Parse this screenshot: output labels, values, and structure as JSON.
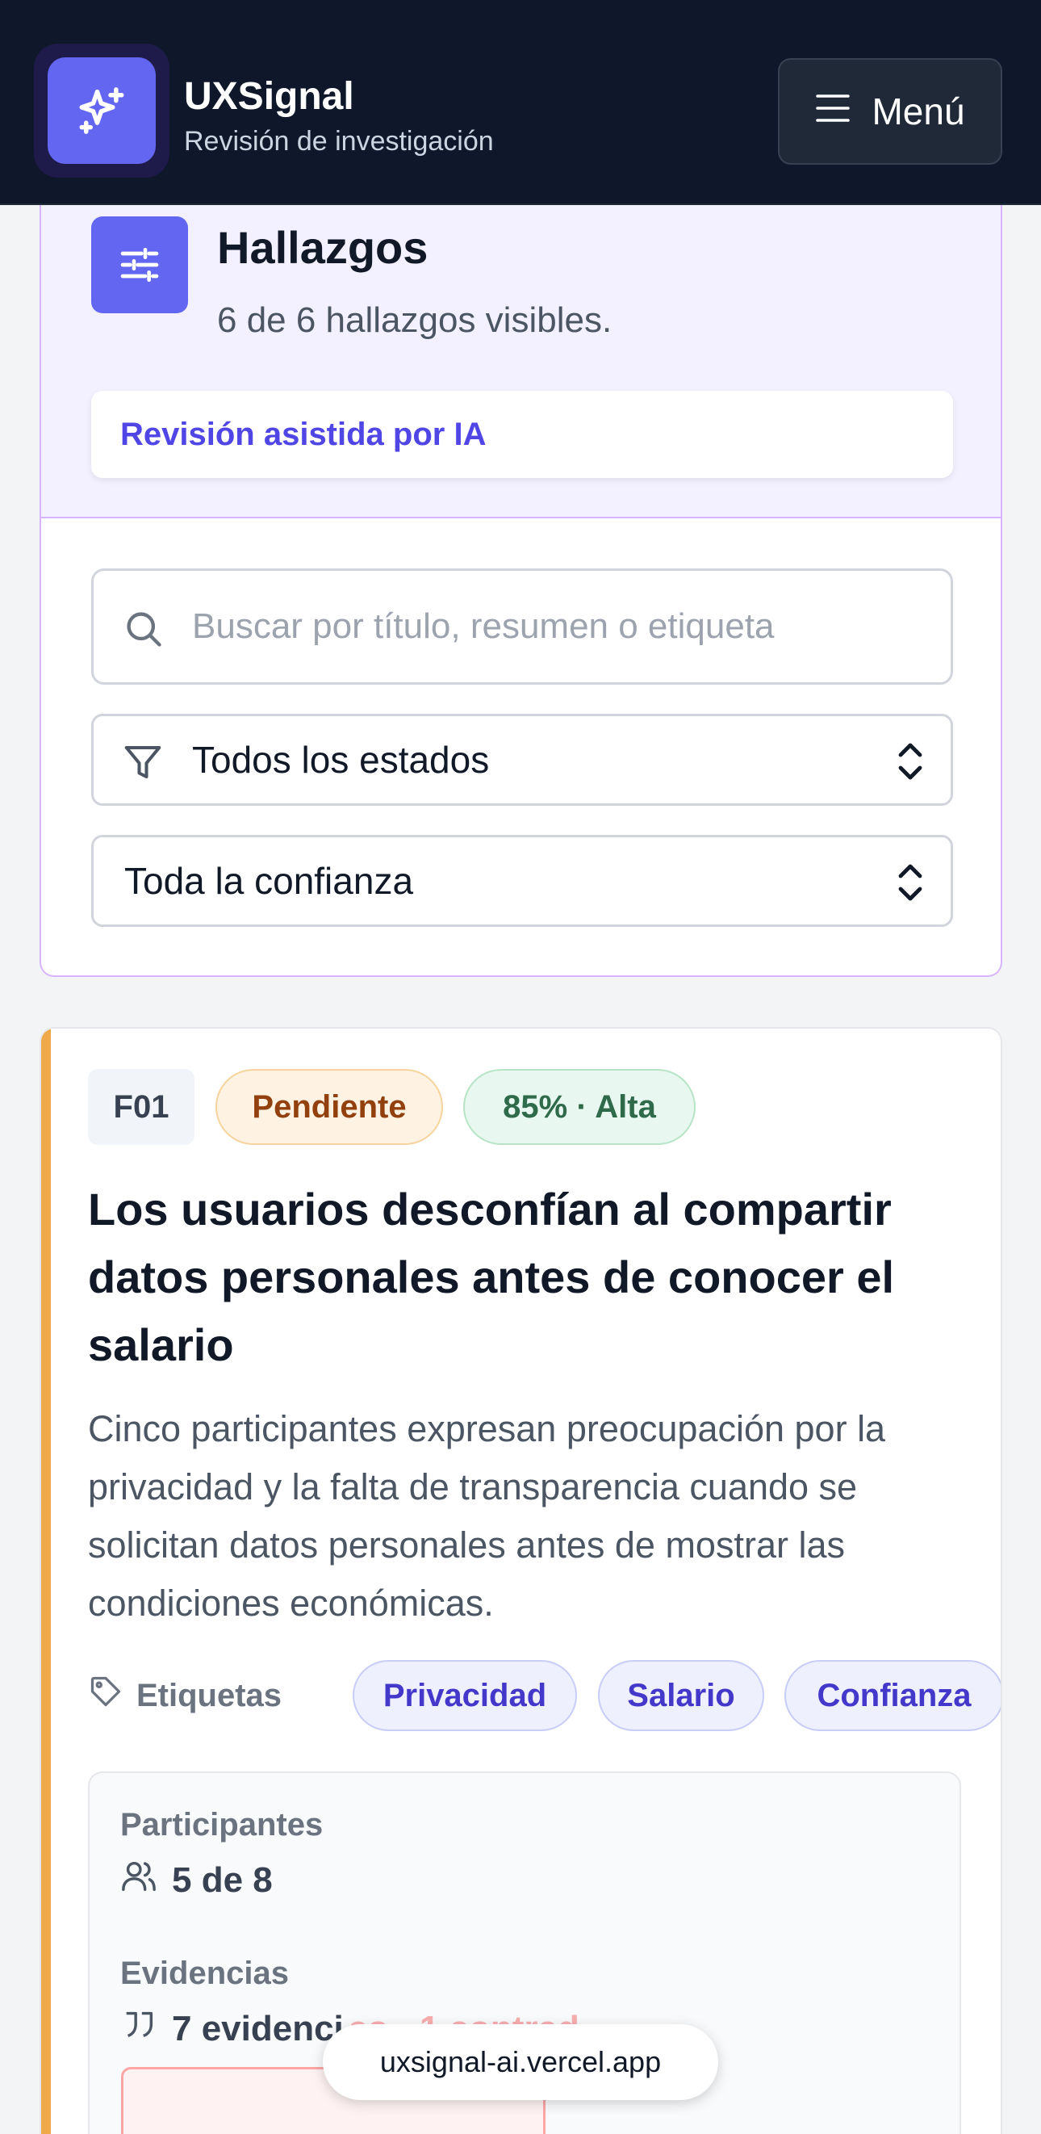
{
  "header": {
    "brand_name": "UXSignal",
    "brand_subtitle": "Revisión de investigación",
    "menu_label": "Menú"
  },
  "filters": {
    "title": "Hallazgos",
    "count_text": "6 de 6 hallazgos visibles.",
    "ai_note": "Revisión asistida por IA",
    "search_placeholder": "Buscar por título, resumen o etiqueta",
    "status_select": "Todos los estados",
    "confidence_select": "Toda la confianza"
  },
  "finding": {
    "id": "F01",
    "status": "Pendiente",
    "confidence": "85% · Alta",
    "title": "Los usuarios desconfían al compartir datos personales antes de conocer el salario",
    "summary": "Cinco participantes expresan preocupación por la privacidad y la falta de transparencia cuando se solicitan datos personales antes de mostrar las condiciones económicas.",
    "tags_label": "Etiquetas",
    "tags": [
      "Privacidad",
      "Salario",
      "Confianza"
    ],
    "participants_label": "Participantes",
    "participants_value": "5 de 8",
    "evidence_label": "Evidencias",
    "evidence_value": "7 evidenci",
    "evidence_tail": "as · 1 contrad."
  },
  "browser": {
    "url": "uxsignal-ai.vercel.app"
  },
  "colors": {
    "header_bg": "#0f172a",
    "accent": "#6366f1",
    "pending": "#92400e",
    "high_confidence": "#2f6b4a",
    "card_accent": "#f0a94a"
  }
}
